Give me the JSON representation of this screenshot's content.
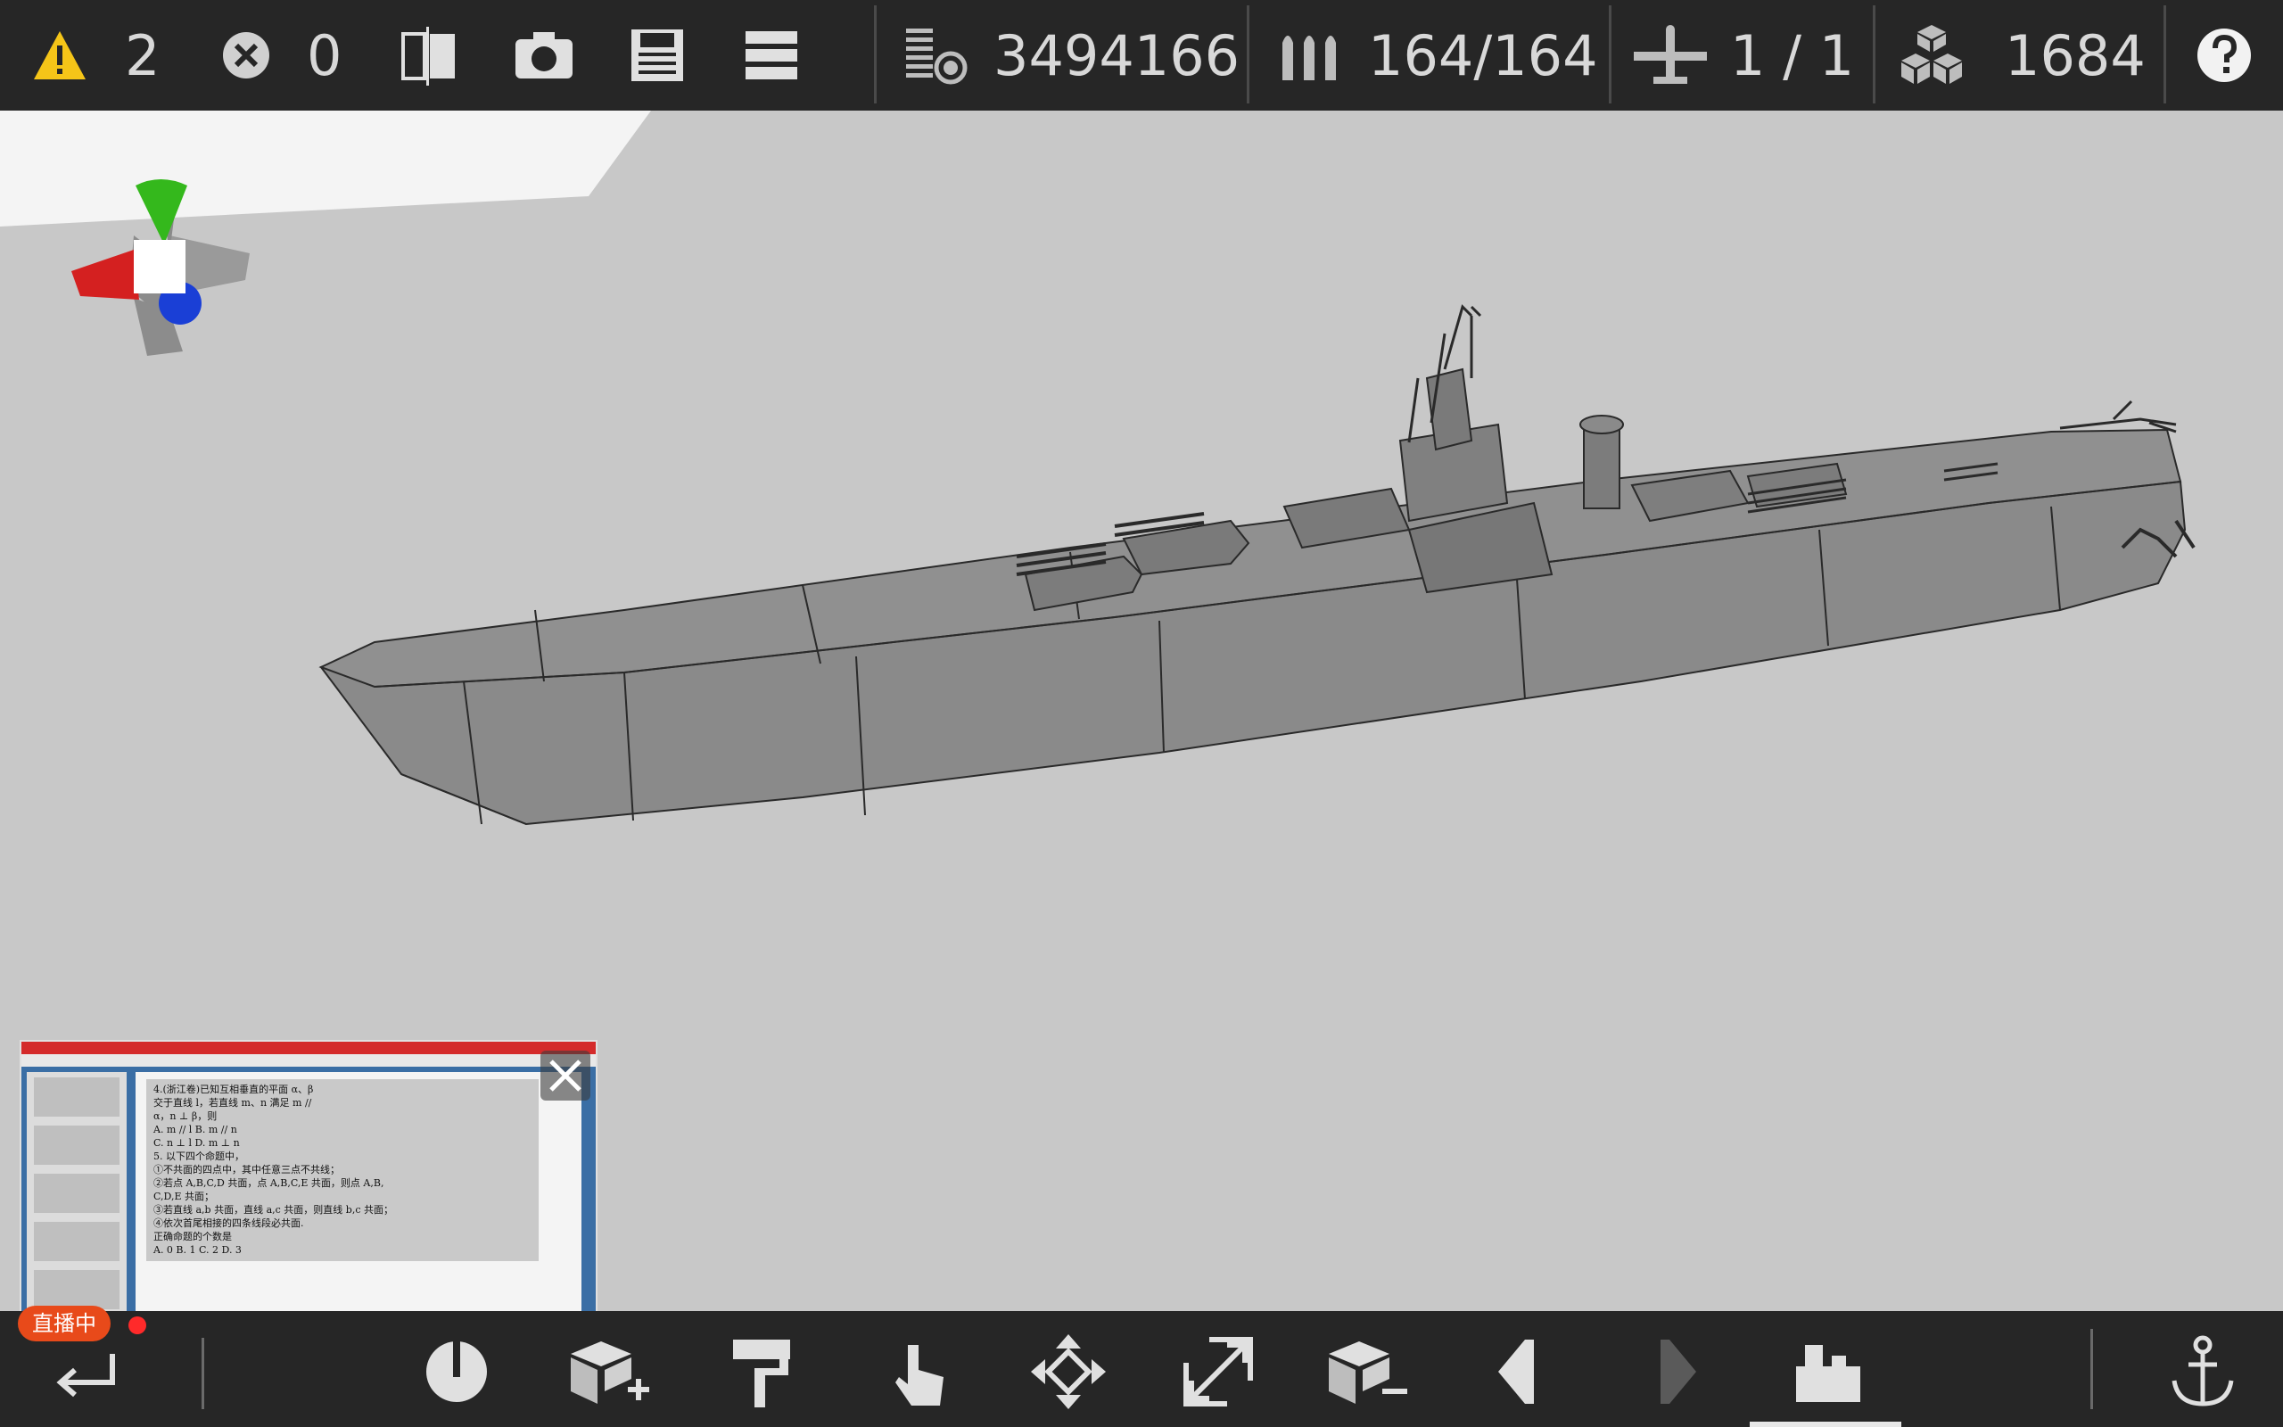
{
  "topbar": {
    "warnings_count": "2",
    "errors_count": "0",
    "weight": "3494166",
    "ammo": "164/164",
    "aircraft": "1 / 1",
    "parts": "1684",
    "icons": {
      "warning": "warning-icon",
      "error": "error-icon",
      "mirror": "mirror-icon",
      "camera": "camera-icon",
      "save": "save-icon",
      "menu": "menu-icon",
      "weight": "weight-icon",
      "ammo": "ammo-icon",
      "aircraft": "aircraft-icon",
      "parts": "parts-icon",
      "help": "help-icon"
    }
  },
  "stream_overlay": {
    "badge": "直播中",
    "document_lines": [
      "4.(浙江卷)已知互相垂直的平面 α、β",
      "交于直线 l，若直线 m、n 满足 m //",
      "α，n ⊥ β，则",
      "A. m // l        B. m // n",
      "C. n ⊥ l        D. m ⊥ n",
      "5. 以下四个命题中，",
      "①不共面的四点中，其中任意三点不共线；",
      "②若点 A,B,C,D 共面，点 A,B,C,E 共面，则点 A,B,",
      "C,D,E 共面；",
      "③若直线 a,b 共面，直线 a,c 共面，则直线 b,c 共面；",
      "④依次首尾相接的四条线段必共面.",
      "正确命题的个数是",
      "A. 0      B. 1      C. 2      D. 3"
    ]
  },
  "bottombar": {
    "tools": [
      "back-icon",
      "rotate-icon",
      "add-block-icon",
      "paint-icon",
      "select-icon",
      "move-icon",
      "scale-icon",
      "remove-block-icon",
      "undo-icon",
      "redo-icon",
      "ship-view-icon",
      "anchor-icon"
    ],
    "active_tool": "ship-view-icon"
  },
  "colors": {
    "bar_bg": "#262626",
    "viewport_bg": "#c8c8c8",
    "warning": "#f5c518",
    "gizmo_x": "#d42020",
    "gizmo_y": "#34b81c",
    "gizmo_z": "#1a3fd6",
    "badge": "#e84a1a"
  }
}
